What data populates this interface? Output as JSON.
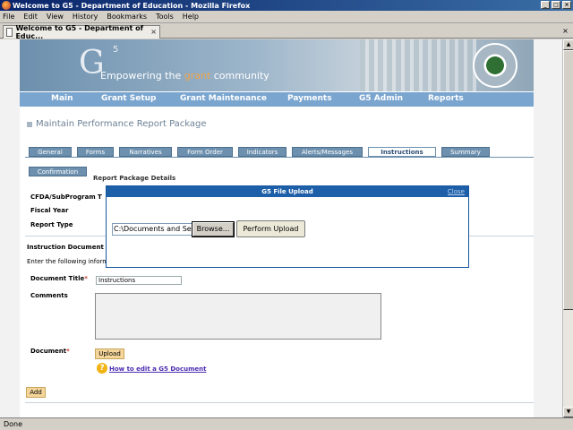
{
  "window": {
    "title": "Welcome to G5 - Department of Education - Mozilla Firefox",
    "minimize": "_",
    "maximize": "□",
    "close": "×"
  },
  "menu": [
    "File",
    "Edit",
    "View",
    "History",
    "Bookmarks",
    "Tools",
    "Help"
  ],
  "browser_tab": {
    "title": "Welcome to G5 - Department of Educ...",
    "close": "×"
  },
  "status": "Done",
  "banner": {
    "logo": "G",
    "logo_sup": "5",
    "slogan_pre": "Empowering the ",
    "slogan_hl": "grant",
    "slogan_post": " community"
  },
  "nav": [
    "Main",
    "Grant Setup",
    "Grant Maintenance",
    "Payments",
    "G5 Admin",
    "Reports"
  ],
  "page_title": "Maintain Performance Report Package",
  "tabs_row1": [
    "General",
    "Forms",
    "Narratives",
    "Form Order",
    "Indicators",
    "Alerts/Messages",
    "Instructions",
    "Summary"
  ],
  "tabs_row2": [
    "Confirmation"
  ],
  "section_title": "Report Package Details",
  "labels": {
    "cfda": "CFDA/SubProgram T",
    "fiscal_year": "Fiscal Year",
    "report_type": "Report Type",
    "instruction_doc": "Instruction Document",
    "enter_info": "Enter the following inform",
    "document_title": "Document Title",
    "comments": "Comments",
    "document": "Document",
    "required": "*"
  },
  "fields": {
    "document_title": "Instructions"
  },
  "buttons": {
    "upload": "Upload",
    "add": "Add"
  },
  "help_link": "How to edit a G5 Document",
  "modal": {
    "title": "G5 File Upload",
    "close": "Close",
    "file_value": "C:\\Documents and Setti",
    "browse": "Browse...",
    "perform": "Perform Upload"
  }
}
